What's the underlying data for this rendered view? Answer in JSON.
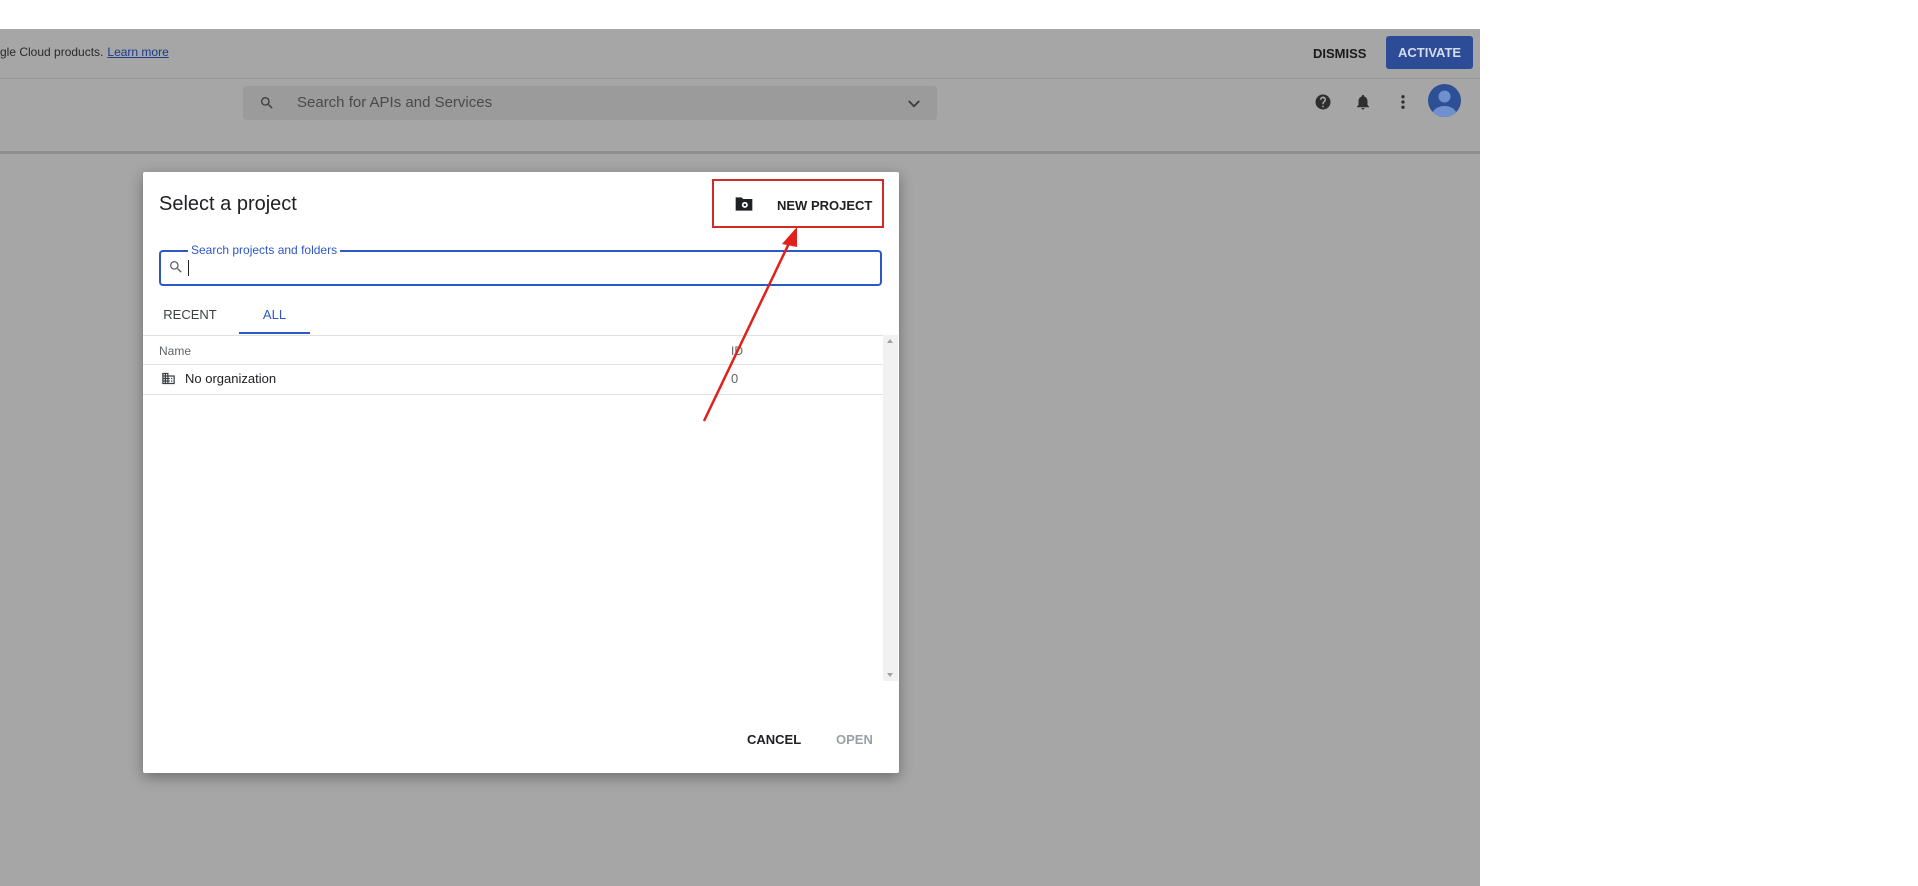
{
  "banner": {
    "text": "gle Cloud products.",
    "link_label": "Learn more",
    "dismiss_label": "DISMISS",
    "activate_label": "ACTIVATE"
  },
  "topbar": {
    "search_placeholder": "Search for APIs and Services",
    "icons": [
      "help-icon",
      "notifications-icon",
      "more-vert-icon",
      "account-avatar"
    ]
  },
  "dialog": {
    "title": "Select a project",
    "new_project_label": "NEW PROJECT",
    "search_label": "Search projects and folders",
    "search_value": "",
    "tabs": [
      {
        "label": "RECENT",
        "active": false
      },
      {
        "label": "ALL",
        "active": true
      }
    ],
    "table": {
      "columns": [
        "Name",
        "ID"
      ],
      "rows": [
        {
          "name": "No organization",
          "id": "0",
          "icon": "organization-icon"
        }
      ]
    },
    "cancel_label": "CANCEL",
    "open_label": "OPEN"
  },
  "colors": {
    "accent": "#2d58c6",
    "highlight_box": "#d12b27",
    "overlay": "#a6a6a6",
    "activate_bg": "#2c4c98"
  }
}
